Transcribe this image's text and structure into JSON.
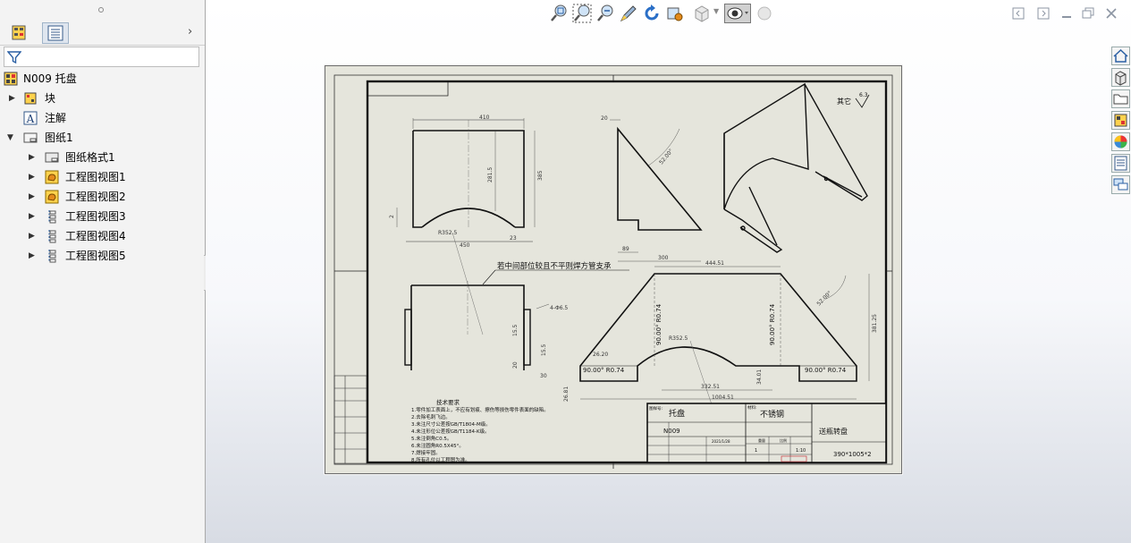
{
  "tree": {
    "root_label": "N009 托盘",
    "items": [
      {
        "label": "块",
        "icon": "block-icon"
      },
      {
        "label": "注解",
        "icon": "annotation-icon"
      },
      {
        "label": "图纸1",
        "icon": "sheet-icon"
      },
      {
        "label": "图纸格式1",
        "icon": "sheet-format-icon"
      },
      {
        "label": "工程图视图1",
        "icon": "drawing-view-icon"
      },
      {
        "label": "工程图视图2",
        "icon": "drawing-view-icon"
      },
      {
        "label": "工程图视图3",
        "icon": "section-view-icon"
      },
      {
        "label": "工程图视图4",
        "icon": "section-view-icon"
      },
      {
        "label": "工程图视图5",
        "icon": "section-view-icon"
      }
    ]
  },
  "hud_icons": [
    "zoom-to-fit-icon",
    "zoom-to-area-icon",
    "zoom-in-out-icon",
    "sketch-pen-icon",
    "rotate-icon",
    "pan-icon",
    "view-orientation-icon",
    "display-style-icon",
    "hide-show-icon",
    "appearance-icon"
  ],
  "drawing": {
    "surface_finish": "其它",
    "surface_value": "6.3",
    "note_callout": "若中间部位较且不平则焊方管支承",
    "dims": {
      "v1_width": "410",
      "v1_height_inner": "281.5",
      "v1_height": "385",
      "v1_left_small": "2",
      "v1_radius": "R352.5",
      "v1_bottom": "450",
      "v1_right_small": "23",
      "v2_top": "20",
      "v2_angle": "52.00°",
      "v2_bottom_small": "89",
      "v2_bottom": "300",
      "v4_hole": "4-Φ6.5",
      "v4_dim_a": "15.5",
      "v4_dim_b": "15.5",
      "v4_dim_c": "20",
      "v4_dim_d": "30",
      "v5_top": "444.51",
      "v5_angle": "52.00°",
      "v5_height": "381.25",
      "v5_radius": "R352.5",
      "v5_left_small": "26.20",
      "v5_bend_l": "90.00° R0.74",
      "v5_bend_r": "90.00° R0.74",
      "v5_bend_vl": "90.00° R0.74",
      "v5_bend_vr": "90.00° R0.74",
      "v5_bottom_inner": "332.51",
      "v5_bottom": "1004.51",
      "v5_left_h": "26.81",
      "v5_mid_h": "34.01"
    },
    "tech_req": {
      "title": "技术要求",
      "lines": [
        "1.零件加工表面上，不应有划痕、擦伤等损伤零件表面的缺陷。",
        "2.去除毛刺飞边。",
        "3.未注尺寸公差按GB/T1804-M级。",
        "4.未注形位公差按GB/T1184-K级。",
        "5.未注倒角C0.5。",
        "6.未注圆角R0.5X45°。",
        "7.焊接牢固。",
        "8.所有孔位以工程图为准。"
      ]
    },
    "title_block": {
      "part_name": "托盘",
      "material": "不锈钢",
      "part_no": "N009",
      "assembly": "送瓶转盘",
      "size": "390*1005*2",
      "date": "2021/1/28",
      "qty": "1",
      "scale": "1:10",
      "labels": {
        "drawing_no_label": "图样号:",
        "material_label": "材料:",
        "weight": "重量",
        "scale": "比例"
      }
    }
  }
}
